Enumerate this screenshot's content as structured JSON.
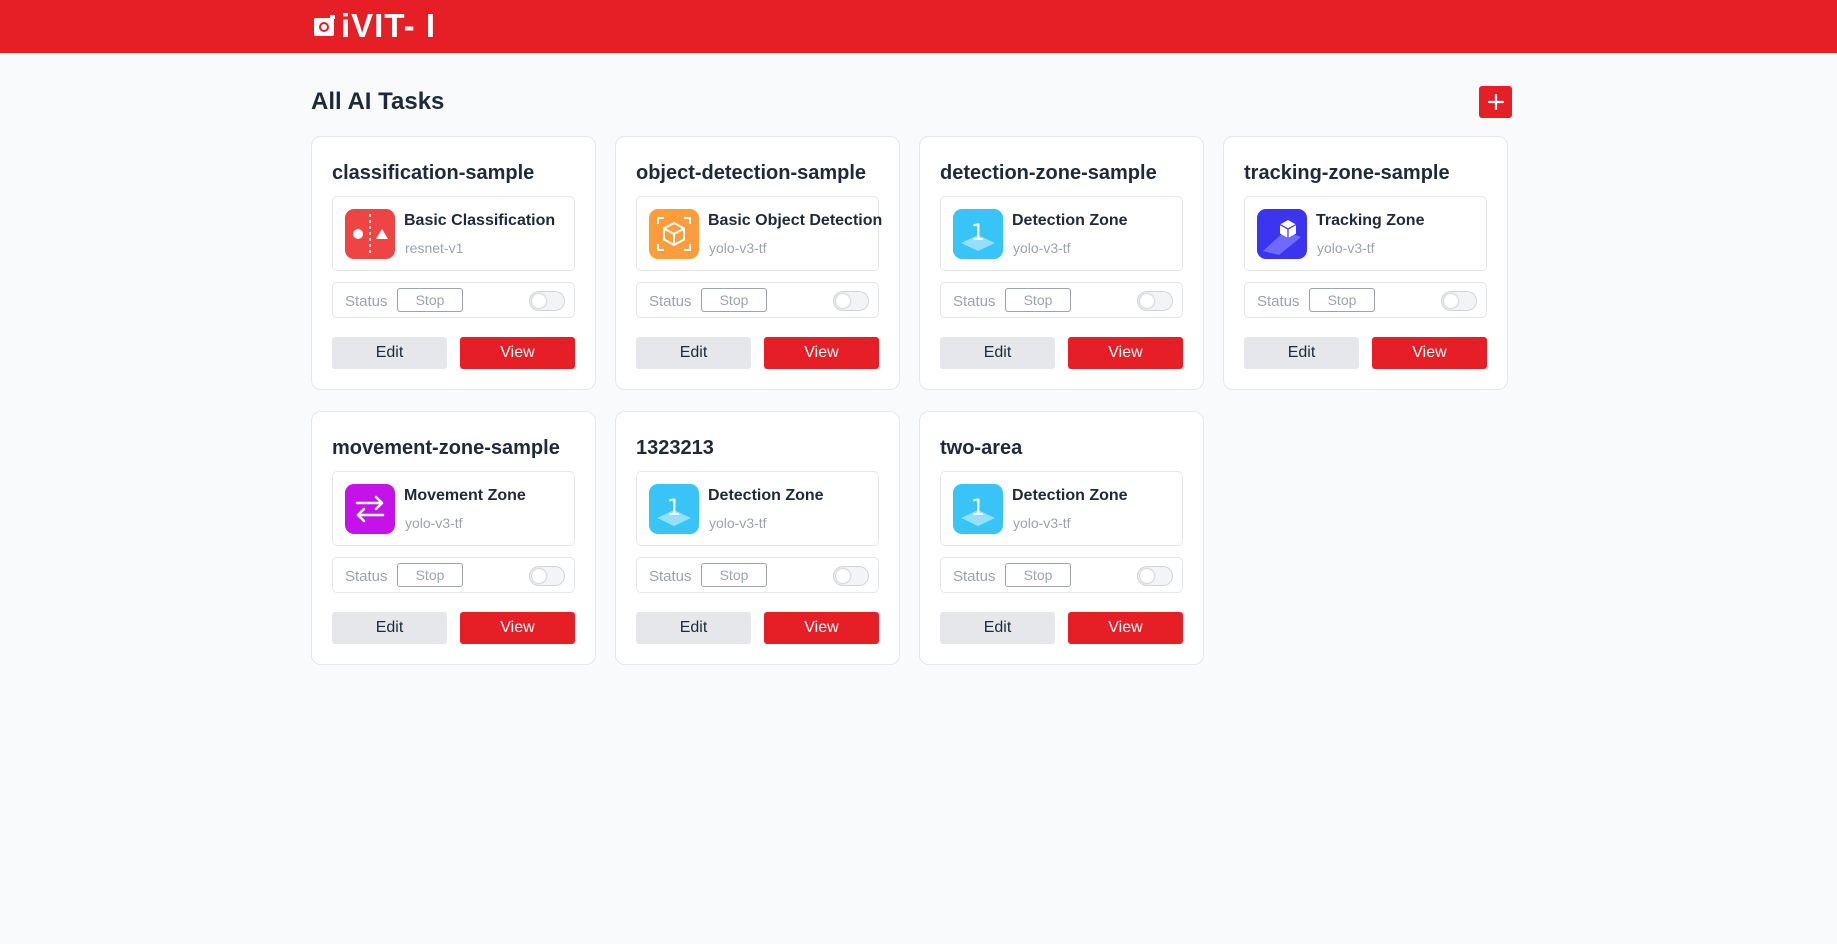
{
  "brand": {
    "logo_text": "iVIT- I",
    "accent": "#e61e25"
  },
  "page": {
    "title": "All AI Tasks",
    "add_icon": "plus-icon"
  },
  "status_label": "Status",
  "edit_label": "Edit",
  "view_label": "View",
  "tasks": [
    {
      "name": "classification-sample",
      "app": "Basic Classification",
      "model": "resnet-v1",
      "status": "Stop",
      "icon": "classification-icon",
      "icon_color": "#ef4444",
      "running": false
    },
    {
      "name": "object-detection-sample",
      "app": "Basic Object Detection",
      "model": "yolo-v3-tf",
      "status": "Stop",
      "icon": "object-detection-icon",
      "icon_color": "#fb9d3c",
      "running": false
    },
    {
      "name": "detection-zone-sample",
      "app": "Detection Zone",
      "model": "yolo-v3-tf",
      "status": "Stop",
      "icon": "detection-zone-icon",
      "icon_color": "#38c4f6",
      "running": false
    },
    {
      "name": "tracking-zone-sample",
      "app": "Tracking Zone",
      "model": "yolo-v3-tf",
      "status": "Stop",
      "icon": "tracking-zone-icon",
      "icon_color": "#3b35f0",
      "running": false
    },
    {
      "name": "movement-zone-sample",
      "app": "Movement Zone",
      "model": "yolo-v3-tf",
      "status": "Stop",
      "icon": "movement-zone-icon",
      "icon_color": "#c512e8",
      "running": false
    },
    {
      "name": "1323213",
      "app": "Detection Zone",
      "model": "yolo-v3-tf",
      "status": "Stop",
      "icon": "detection-zone-icon",
      "icon_color": "#38c4f6",
      "running": false
    },
    {
      "name": "two-area",
      "app": "Detection Zone",
      "model": "yolo-v3-tf",
      "status": "Stop",
      "icon": "detection-zone-icon",
      "icon_color": "#38c4f6",
      "running": false
    }
  ]
}
